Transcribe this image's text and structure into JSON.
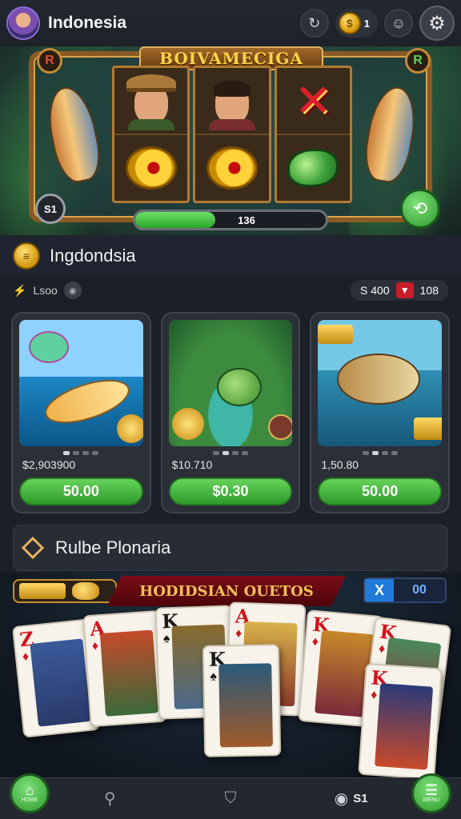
{
  "header": {
    "title": "Indonesia",
    "coin_count": "1",
    "icons": [
      "avatar",
      "refresh-icon",
      "coin-icon",
      "chat-icon",
      "gear-icon"
    ]
  },
  "slot": {
    "title": "BOIVAMECIGA",
    "corner_left": "R",
    "corner_right": "R",
    "level": "S1",
    "progress_label": "136",
    "progress": 0.42,
    "reel_symbols": [
      [
        "explorer-face",
        "gold-fish-coin"
      ],
      [
        "man-face",
        "gold-fish-coin"
      ],
      [
        "red-x",
        "green-fish"
      ]
    ]
  },
  "section": {
    "title": "Ingdondsia",
    "filter_left": "Lsoo",
    "filter_right_a": "S 400",
    "filter_right_b": "108"
  },
  "games": [
    {
      "price": "$2,903900",
      "button": "50.00",
      "active_dot": 0
    },
    {
      "price": "$10.710",
      "button": "$0.30",
      "active_dot": 1
    },
    {
      "price": "1,50.80",
      "button": "50.00",
      "active_dot": 1
    }
  ],
  "rules": {
    "title": "Rulbe Plonaria"
  },
  "table": {
    "ribbon": "HODIDSIAN OUETOS",
    "vs_x": "X",
    "vs_score": "00",
    "cards": [
      {
        "rank": "Z",
        "suit": "♦",
        "color": "red"
      },
      {
        "rank": "A",
        "suit": "♦",
        "color": "red"
      },
      {
        "rank": "K",
        "suit": "♠",
        "color": "blk"
      },
      {
        "rank": "A",
        "suit": "♦",
        "color": "red"
      },
      {
        "rank": "K",
        "suit": "♠",
        "color": "blk"
      },
      {
        "rank": "K",
        "suit": "♦",
        "color": "red"
      },
      {
        "rank": "K",
        "suit": "♦",
        "color": "red"
      },
      {
        "rank": "K",
        "suit": "♦",
        "color": "red"
      }
    ]
  },
  "nav": {
    "home_label": "HOME",
    "balance": "S1",
    "right_label": "MENU"
  },
  "colors": {
    "accent_green": "#2f9a2b",
    "gold": "#e3b35b",
    "ribbon_red": "#7a0d16"
  }
}
